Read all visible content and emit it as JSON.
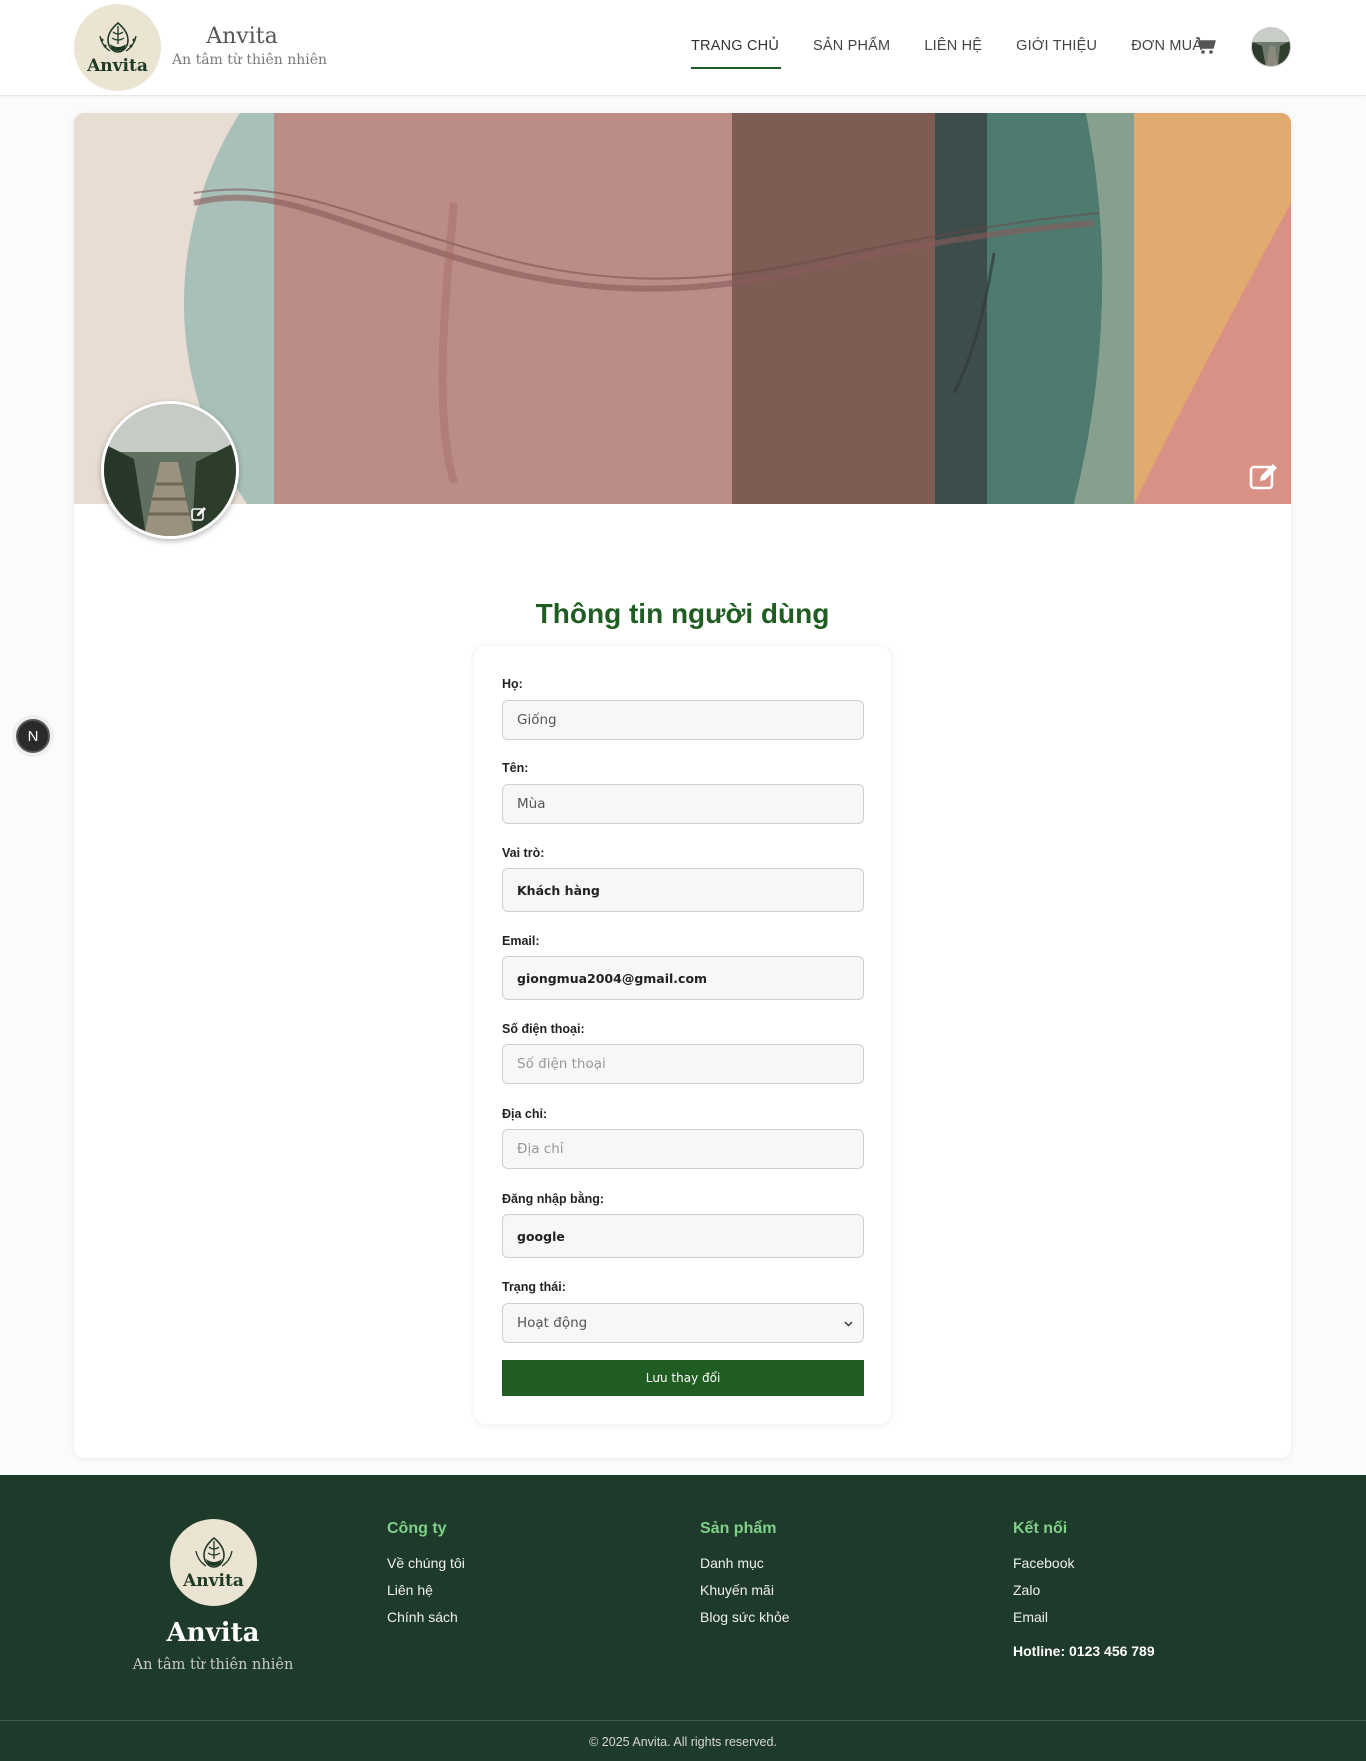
{
  "header": {
    "logo_text": "Anvita",
    "brand_name": "Anvita",
    "tagline": "An tâm từ thiên nhiên",
    "nav": [
      "TRANG CHỦ",
      "SẢN PHẨM",
      "LIÊN HỆ",
      "GIỚI THIỆU",
      "ĐƠN MUA"
    ],
    "active_nav": "TRANG CHỦ",
    "cart_icon": "cart-icon",
    "accent_color": "#1f5d22"
  },
  "profile": {
    "title": "Thông tin người dùng",
    "fields": {
      "ho": {
        "label": "Họ:",
        "value": "Giống"
      },
      "ten": {
        "label": "Tên:",
        "value": "Mùa"
      },
      "vai_tro": {
        "label": "Vai trò:",
        "value": "Khách hàng"
      },
      "email": {
        "label": "Email:",
        "value": "giongmua2004@gmail.com"
      },
      "sdt": {
        "label": "Số điện thoại:",
        "placeholder": "Số điện thoại"
      },
      "dia_chi": {
        "label": "Địa chỉ:",
        "placeholder": "Địa chỉ"
      },
      "dang_nhap": {
        "label": "Đăng nhập bằng:",
        "value": "google"
      },
      "trang_thai": {
        "label": "Trạng thái:",
        "value": "Hoạt động"
      }
    },
    "save_label": "Lưu thay đổi"
  },
  "badge": {
    "letter": "N"
  },
  "footer": {
    "logo_text": "Anvita",
    "brand_name": "Anvita",
    "tagline": "An tâm từ thiên nhiên",
    "cong_ty": {
      "title": "Công ty",
      "links": [
        "Về chúng tôi",
        "Liên hệ",
        "Chính sách"
      ]
    },
    "san_pham": {
      "title": "Sản phẩm",
      "links": [
        "Danh mục",
        "Khuyến mãi",
        "Blog sức khỏe"
      ]
    },
    "ket_noi": {
      "title": "Kết nối",
      "links": [
        "Facebook",
        "Zalo",
        "Email"
      ]
    },
    "hotline": "Hotline: 0123 456 789",
    "copyright": "© 2025 Anvita. All rights reserved."
  }
}
